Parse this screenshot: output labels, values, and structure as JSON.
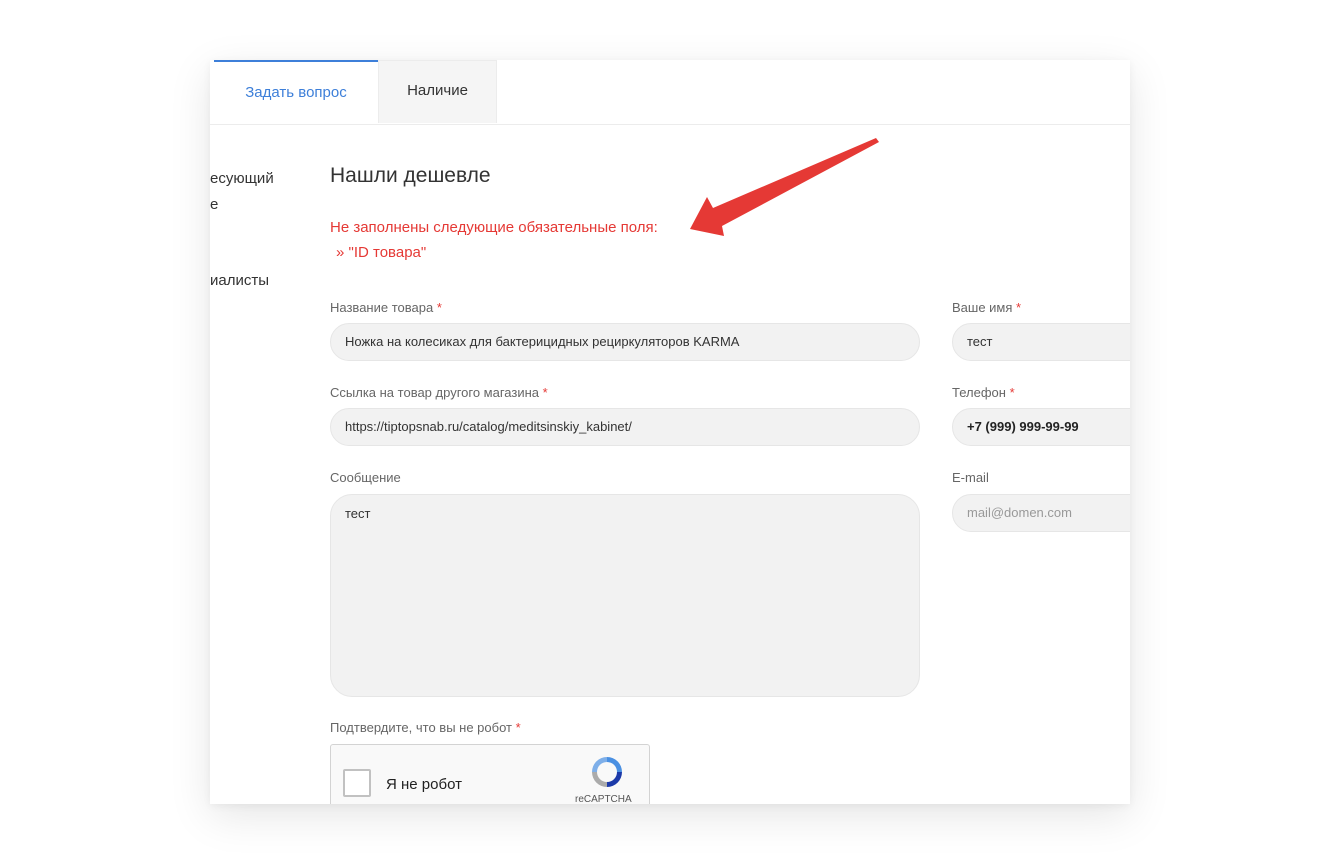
{
  "tabs": {
    "ask_label": "Задать вопрос",
    "stock_label": "Наличие"
  },
  "sidebar": {
    "line1": "есующий",
    "line2": "е",
    "line3": "иалисты"
  },
  "form": {
    "title": "Нашли дешевле",
    "error_title": "Не заполнены следующие обязательные поля:",
    "error_item": "» \"ID товара\"",
    "required_mark": "*",
    "product_name": {
      "label": "Название товара",
      "value": "Ножка на колесиках для бактерицидных рециркуляторов KARMA"
    },
    "other_link": {
      "label": "Ссылка на товар другого магазина",
      "value": "https://tiptopsnab.ru/catalog/meditsinskiy_kabinet/"
    },
    "message": {
      "label": "Сообщение",
      "value": "тест"
    },
    "your_name": {
      "label": "Ваше имя",
      "value": "тест"
    },
    "phone": {
      "label": "Телефон",
      "value": "+7 (999) 999-99-99"
    },
    "email": {
      "label": "E-mail",
      "placeholder": "mail@domen.com"
    },
    "captcha": {
      "label": "Подтвердите, что вы не робот",
      "checkbox_label": "Я не робот",
      "brand": "reCAPTCHA"
    }
  },
  "colors": {
    "accent": "#3d7fd9",
    "error": "#e53935",
    "arrow": "#e53935"
  }
}
